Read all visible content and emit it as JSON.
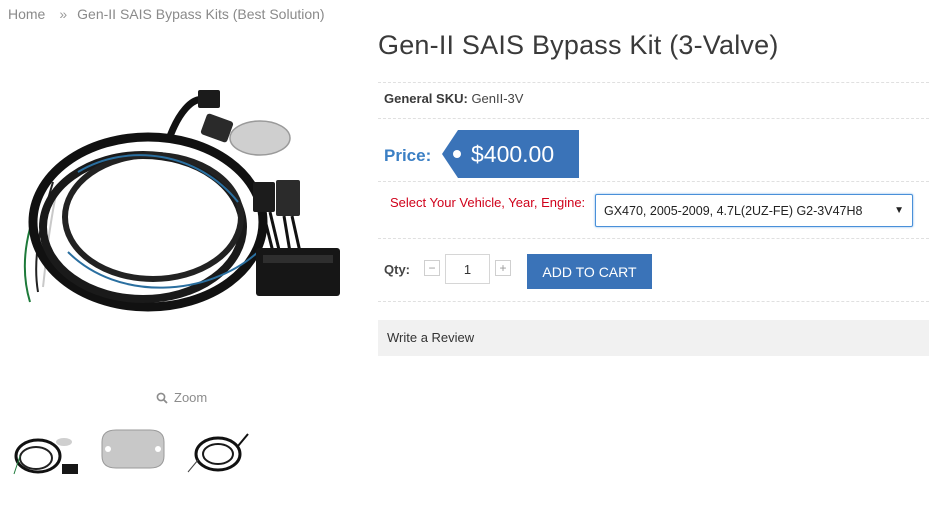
{
  "breadcrumb": {
    "home": "Home",
    "separator": "»",
    "category": "Gen-II SAIS Bypass Kits (Best Solution)"
  },
  "product": {
    "title": "Gen-II SAIS Bypass Kit (3-Valve)",
    "sku_label": "General SKU:",
    "sku_value": "GenII-3V",
    "price_label": "Price:",
    "price": "$400.00"
  },
  "gallery": {
    "zoom_label": "Zoom",
    "thumbnails": [
      "wiring-harness-kit",
      "block-off-plate",
      "wiring-harness-coil"
    ]
  },
  "options": {
    "vehicle_label": "Select Your Vehicle, Year, Engine:",
    "vehicle_selected": "GX470, 2005-2009, 4.7L(2UZ-FE) G2-3V47H8"
  },
  "purchase": {
    "qty_label": "Qty:",
    "qty_value": "1",
    "minus": "−",
    "plus": "+",
    "add_to_cart": "ADD TO CART"
  },
  "review": {
    "label": "Write a Review"
  },
  "colors": {
    "accent_blue": "#3a73b8",
    "price_label_blue": "#3b7fc4",
    "required_red": "#d0021b",
    "review_bg": "#f1f1f1"
  }
}
